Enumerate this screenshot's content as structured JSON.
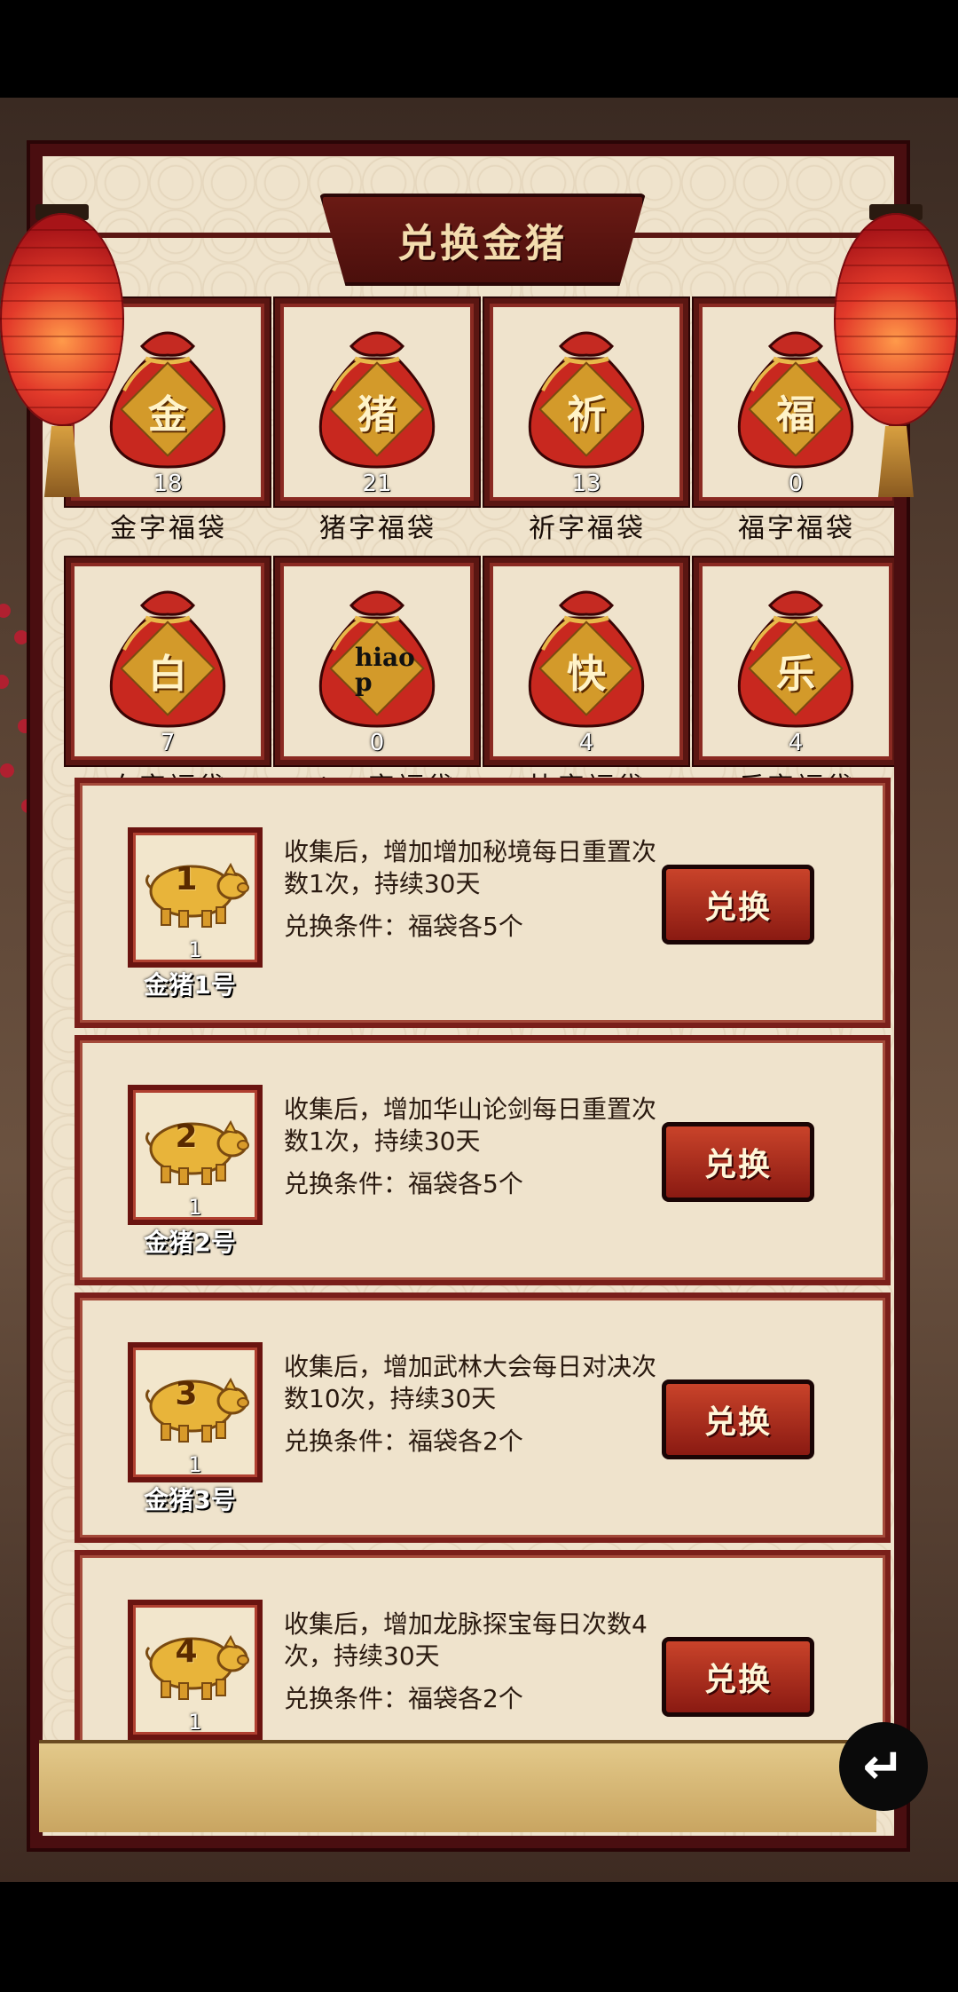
{
  "title": "兑换金猪",
  "bags": [
    {
      "char": "金",
      "count": "18",
      "label": "金字福袋"
    },
    {
      "char": "猪",
      "count": "21",
      "label": "猪字福袋"
    },
    {
      "char": "祈",
      "count": "13",
      "label": "祈字福袋"
    },
    {
      "char": "福",
      "count": "0",
      "label": "福字福袋"
    },
    {
      "char": "白",
      "count": "7",
      "label": "白字福袋"
    },
    {
      "char": "hiao p",
      "count": "0",
      "label": "piao字福袋"
    },
    {
      "char": "快",
      "count": "4",
      "label": "快字福袋"
    },
    {
      "char": "乐",
      "count": "4",
      "label": "乐字福袋"
    }
  ],
  "rewards": [
    {
      "num": "1",
      "count": "1",
      "name": "金猪1号",
      "desc": "收集后，增加增加秘境每日重置次数1次，持续30天",
      "cond": "兑换条件：福袋各5个",
      "button": "兑换"
    },
    {
      "num": "2",
      "count": "1",
      "name": "金猪2号",
      "desc": "收集后，增加华山论剑每日重置次数1次，持续30天",
      "cond": "兑换条件：福袋各5个",
      "button": "兑换"
    },
    {
      "num": "3",
      "count": "1",
      "name": "金猪3号",
      "desc": "收集后，增加武林大会每日对决次数10次，持续30天",
      "cond": "兑换条件：福袋各2个",
      "button": "兑换"
    },
    {
      "num": "4",
      "count": "1",
      "name": "",
      "desc": "收集后，增加龙脉探宝每日次数4次，持续30天",
      "cond": "兑换条件：福袋各2个",
      "button": "兑换"
    }
  ],
  "back_icon": "↵",
  "colors": {
    "frame": "#5a1612",
    "parchment": "#efe3cc",
    "button": "#b0301f",
    "gold": "#e8b84a"
  }
}
